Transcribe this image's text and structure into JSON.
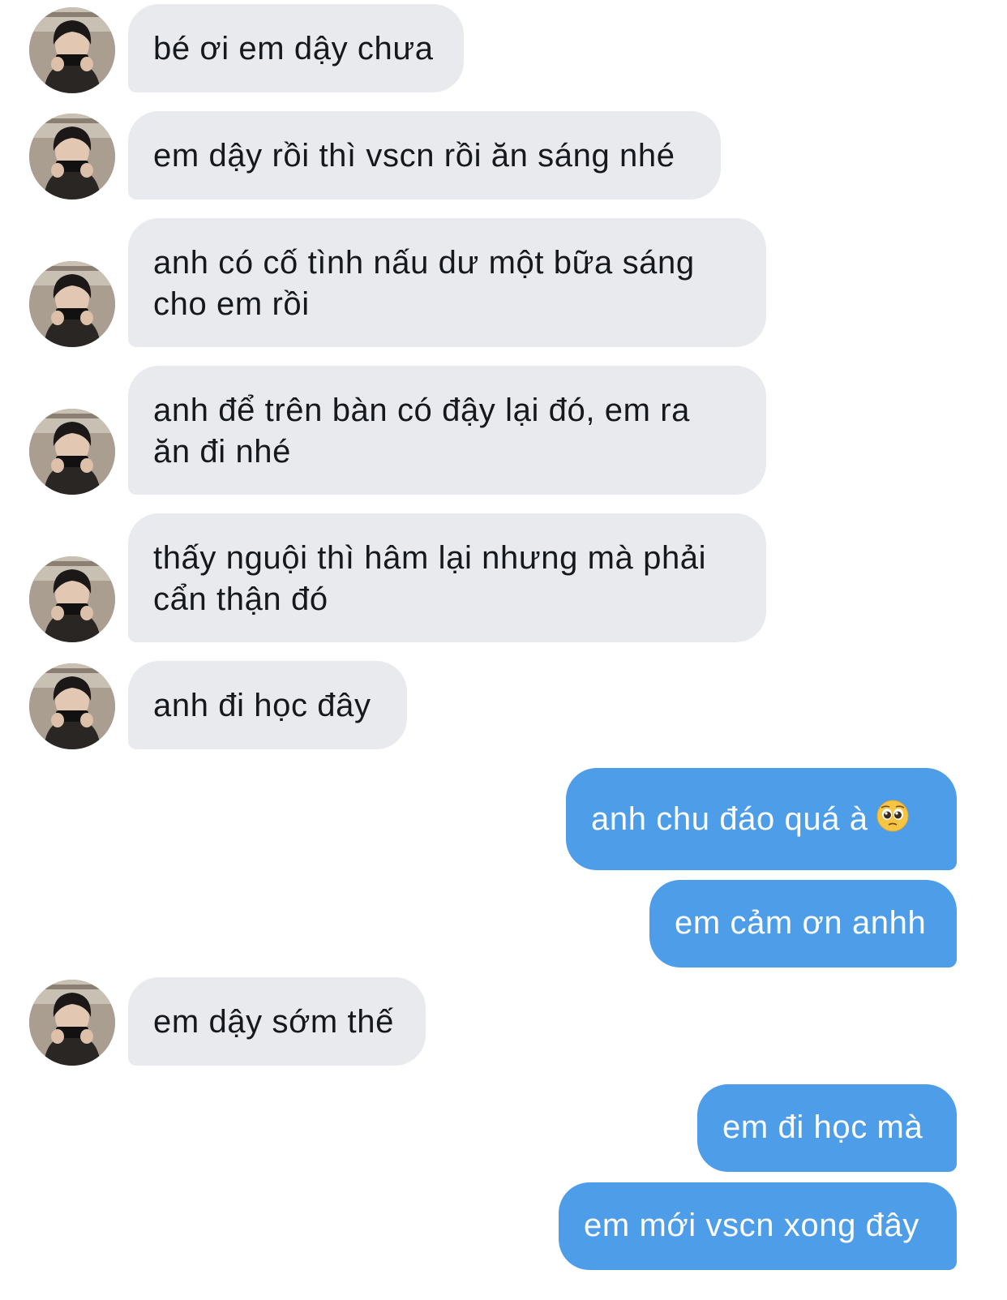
{
  "conversation": {
    "messages": [
      {
        "sender": "contact",
        "text": "bé ơi em dậy chưa"
      },
      {
        "sender": "contact",
        "text": "em dậy rồi thì vscn rồi ăn sáng nhé"
      },
      {
        "sender": "contact",
        "line1": "anh có cố tình nấu dư một bữa sáng",
        "line2": "cho em rồi"
      },
      {
        "sender": "contact",
        "line1": "anh để trên bàn có đậy lại đó, em ra",
        "line2": "ăn đi nhé"
      },
      {
        "sender": "contact",
        "line1": "thấy nguội thì hâm lại nhưng mà phải",
        "line2": "cẩn thận đó"
      },
      {
        "sender": "contact",
        "text": "anh đi học đây"
      },
      {
        "sender": "me",
        "text": "anh chu đáo quá à",
        "emoji_icon": "pleading-face-icon"
      },
      {
        "sender": "me",
        "text": "em cảm ơn anhh"
      },
      {
        "sender": "contact",
        "text": "em dậy sớm thế"
      },
      {
        "sender": "me",
        "text": "em đi học mà"
      },
      {
        "sender": "me",
        "text": "em mới vscn xong đây"
      }
    ]
  },
  "colors": {
    "incoming_bubble": "#e8eaee",
    "outgoing_bubble": "#4d9de9",
    "incoming_text": "#15181c",
    "outgoing_text": "#ffffff"
  },
  "icons": {
    "avatar": "contact-avatar-photo",
    "emoji": "pleading-face-icon"
  }
}
